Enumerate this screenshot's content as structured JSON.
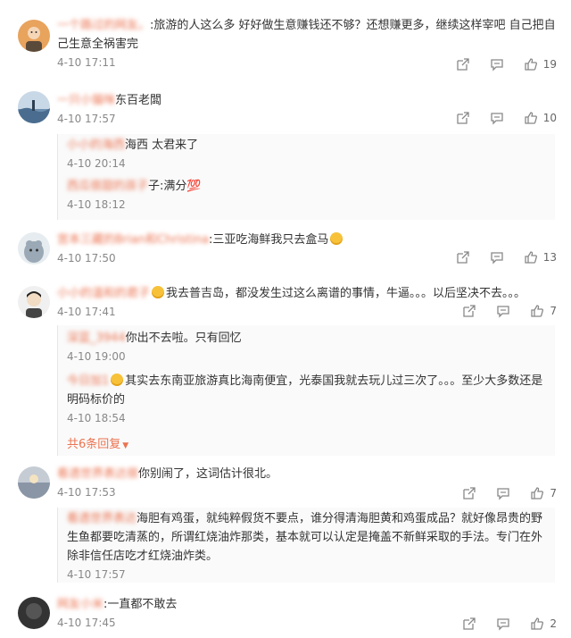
{
  "comments": [
    {
      "username": "一个路过的网友。",
      "text": ":旅游的人这么多 好好做生意赚钱还不够？还想赚更多，继续这样宰吧 自己把自己生意全祸害完",
      "time": "4-10 17:11",
      "likes": "19",
      "avatar_color": "#e8a35d"
    },
    {
      "username": "一只小猫咪",
      "text": "东百老闆",
      "time": "4-10 17:57",
      "likes": "10",
      "avatar_color": "#6d8fb0",
      "replies": [
        {
          "username": "小小的海西",
          "text": "海西 太君来了",
          "time": "4-10 20:14"
        },
        {
          "username": "西瓜很甜的孩子",
          "text": "子:满分💯",
          "time": "4-10 18:12"
        }
      ]
    },
    {
      "username": "宫本三藏的Brian和Christina",
      "text": ":三亚吃海鲜我只去盒马",
      "time": "4-10 17:50",
      "likes": "13",
      "avatar_color": "#9aa9b5"
    },
    {
      "username": "小小的温和的君子",
      "text": "我去普吉岛，都没发生过这么离谱的事情，牛逼。。。以后坚决不去。。。",
      "time": "4-10 17:41",
      "likes": "7",
      "avatar_color": "#d9d9d9",
      "replies": [
        {
          "username": "深蓝_3944",
          "text": "你出不去啦。只有回忆",
          "time": "4-10 19:00"
        },
        {
          "username": "今日加1",
          "text": "其实去东南亚旅游真比海南便宜，光泰国我就去玩儿过三次了。。。至少大多数还是明码标价的",
          "time": "4-10 18:54"
        }
      ],
      "more_label": "共6条回复"
    },
    {
      "username": "看透世界表达很",
      "text": "你别闹了，这词估计很北。",
      "time": "4-10 17:53",
      "likes": "7",
      "avatar_color": "#8a96a5",
      "replies": [
        {
          "username": "看透世界表达",
          "text": "海胆有鸡蛋，就纯粹假货不要点，谁分得清海胆黄和鸡蛋成品？就好像昂贵的野生鱼都要吃清蒸的，所谓红烧油炸那类，基本就可以认定是掩盖不新鲜采取的手法。专门在外除非信任店吃才红烧油炸类。",
          "time": "4-10 17:57"
        }
      ]
    },
    {
      "username": "网友小米",
      "text": ":一直都不敢去",
      "time": "4-10 17:45",
      "likes": "2",
      "avatar_color": "#333333"
    }
  ],
  "icons": {
    "share": "share-icon",
    "comment": "comment-icon",
    "like": "like-icon",
    "more_caret": "caret-down-icon"
  },
  "colors": {
    "username": "#eb7350",
    "time": "#888888",
    "text": "#333333"
  }
}
